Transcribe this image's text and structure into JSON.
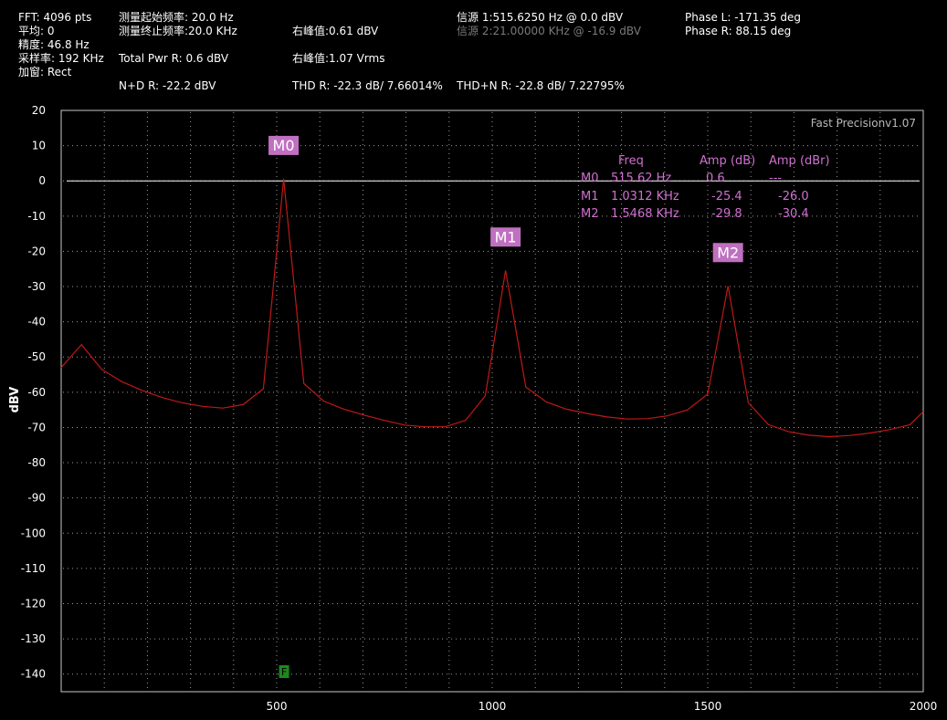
{
  "header": {
    "fft": "FFT: 4096 pts",
    "avg": "平均: 0",
    "precision": "精度: 46.8 Hz",
    "sample_rate": "采样率: 192 KHz",
    "window": "加窗: Rect",
    "start_freq": "测量起始频率: 20.0 Hz",
    "stop_freq": "测量终止频率:20.0 KHz",
    "total_pwr": "Total Pwr R: 0.6 dBV",
    "nd": "N+D R: -22.2 dBV",
    "peak_dbv": "右峰值:0.61 dBV",
    "peak_vrms": "右峰值:1.07 Vrms",
    "thd": "THD R: -22.3 dB/ 7.66014%",
    "thdn": "THD+N R: -22.8 dB/ 7.22795%",
    "source1": "信源 1:515.6250  Hz @ 0.0  dBV",
    "source2": "信源 2:21.00000 KHz @ -16.9  dBV",
    "phase_l": "Phase L: -171.35 deg",
    "phase_r": "Phase R: 88.15 deg"
  },
  "brand": "Fast Precisionv1.07",
  "colors": {
    "trace": "#c01818",
    "marker": "#c070c0",
    "grid": "#9a9a9a",
    "ref_line": "#ffffff",
    "f_marker": "#1a8a1a"
  },
  "marker_table": {
    "headers": [
      "Freq",
      "Amp (dB)",
      "Amp (dBr)"
    ],
    "rows": [
      {
        "name": "M0",
        "freq": "515.62 Hz",
        "amp_db": "0.6",
        "amp_dbr": "---"
      },
      {
        "name": "M1",
        "freq": "1.0312 KHz",
        "amp_db": "-25.4",
        "amp_dbr": "-26.0"
      },
      {
        "name": "M2",
        "freq": "1.5468 KHz",
        "amp_db": "-29.8",
        "amp_dbr": "-30.4"
      }
    ]
  },
  "f_marker_label": "F",
  "chart_data": {
    "type": "line",
    "title": "",
    "xlabel": "",
    "ylabel": "dBV",
    "xlim": [
      0,
      2000
    ],
    "ylim": [
      -145,
      20
    ],
    "x_ticks": [
      500,
      1000,
      1500,
      2000
    ],
    "y_ticks": [
      20,
      10,
      0,
      -10,
      -20,
      -30,
      -40,
      -50,
      -60,
      -70,
      -80,
      -90,
      -100,
      -110,
      -120,
      -130,
      -140
    ],
    "grid": true,
    "reference_level": 0,
    "series": [
      {
        "x": [
          0,
          47,
          94,
          141,
          188,
          234,
          281,
          328,
          375,
          422,
          469,
          500,
          516,
          563,
          609,
          656,
          703,
          750,
          797,
          844,
          891,
          938,
          984,
          1031,
          1078,
          1125,
          1172,
          1219,
          1266,
          1313,
          1359,
          1406,
          1453,
          1500,
          1547,
          1594,
          1641,
          1688,
          1734,
          1781,
          1828,
          1875,
          1922,
          1969,
          2000
        ],
        "y": [
          -53,
          -46.5,
          -53.5,
          -57,
          -59.5,
          -61.5,
          -63,
          -64,
          -64.5,
          -63.5,
          -59,
          -20,
          0.6,
          -57.5,
          -62.5,
          -64.8,
          -66.5,
          -68,
          -69.3,
          -69.8,
          -69.8,
          -68,
          -61,
          -25.4,
          -58.5,
          -62.7,
          -64.8,
          -66,
          -67,
          -67.6,
          -67.5,
          -66.7,
          -65,
          -60.5,
          -29.8,
          -63,
          -69.2,
          -71.2,
          -72.2,
          -72.6,
          -72.3,
          -71.6,
          -70.6,
          -69.2,
          -65.5
        ]
      }
    ],
    "markers": [
      {
        "name": "M0",
        "x": 516,
        "y": 0.6
      },
      {
        "name": "M1",
        "x": 1031,
        "y": -25.4
      },
      {
        "name": "M2",
        "x": 1547,
        "y": -29.8
      }
    ],
    "f_marker_x": 516
  }
}
